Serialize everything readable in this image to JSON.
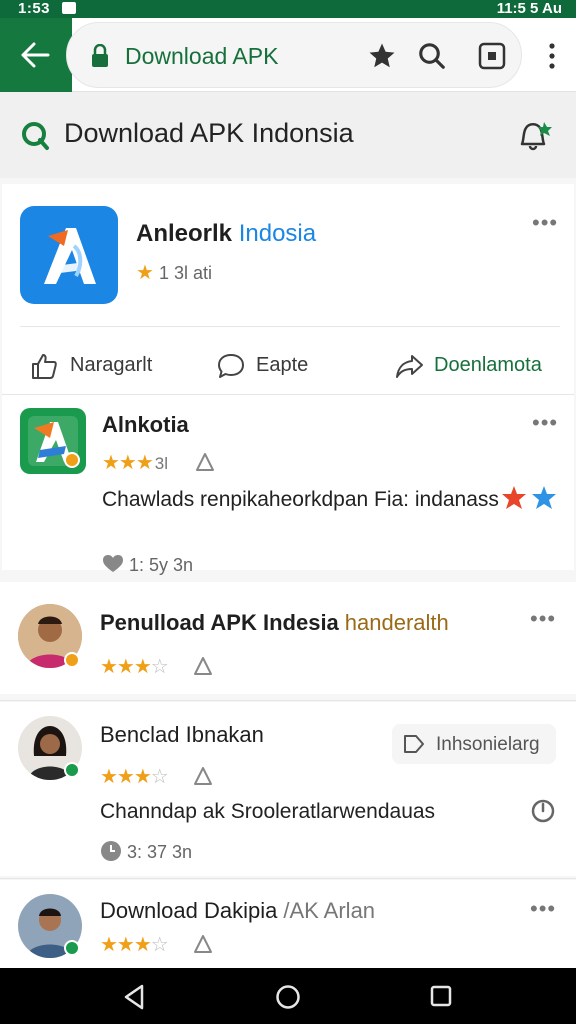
{
  "status_bar": {
    "time": "1:53",
    "right_text": "11:5 5 Au"
  },
  "browser": {
    "url": "Download APK"
  },
  "site": {
    "title": "Download APK Indonsia"
  },
  "main_card": {
    "title": "Anleorlk",
    "title_accent": "Indosia",
    "rating": "1 3l ati",
    "actions": {
      "like": "Naragarlt",
      "comment": "Eapte",
      "share": "Doenlamota"
    }
  },
  "posts": [
    {
      "title": "Alnkotia",
      "stars_sub": "3l",
      "body": "Chawlads renpikaheorkdpan Fia: indanass",
      "meta": "1: 5y   3n"
    },
    {
      "title": "Penulload APK Indesia",
      "tag": "handeralth"
    },
    {
      "title": "Benclad Ibnakan",
      "chip": "Inhsonielarg",
      "body": "Channdap ak Srooleratlarwendauas",
      "meta": "3: 37   3n"
    },
    {
      "title": "Download Dakipia",
      "tag": "/AK Arlan"
    }
  ],
  "colors": {
    "brand_green": "#15793f",
    "link_blue": "#1b86e3",
    "star": "#f0a018"
  }
}
